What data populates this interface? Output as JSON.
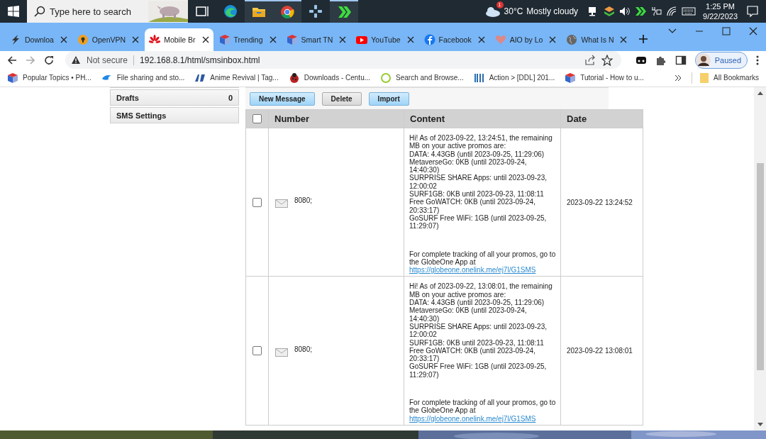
{
  "taskbar": {
    "search": {
      "placeholder": "Type here to search"
    },
    "apps": [
      {
        "kind": "taskview",
        "running": false
      },
      {
        "kind": "edge",
        "running": false
      },
      {
        "kind": "folder",
        "running": true
      },
      {
        "kind": "chrome",
        "running": true
      },
      {
        "kind": "gamepad",
        "running": false
      },
      {
        "kind": "chevrons",
        "running": true
      }
    ],
    "weather": {
      "badge": "1",
      "temperature": "30°C",
      "condition": "Mostly cloudy"
    },
    "clock": {
      "time": "1:25 PM",
      "date": "9/22/2023"
    }
  },
  "browser": {
    "tabs": [
      {
        "label": "Downloa",
        "kind": "bolt",
        "selected": false
      },
      {
        "label": "OpenVPN",
        "kind": "lock",
        "selected": false
      },
      {
        "label": "Mobile Br",
        "kind": "flower",
        "selected": true
      },
      {
        "label": "Trending",
        "kind": "cube",
        "selected": false
      },
      {
        "label": "Smart TN",
        "kind": "cube",
        "selected": false
      },
      {
        "label": "YouTube",
        "kind": "play",
        "selected": false
      },
      {
        "label": "Facebook",
        "kind": "facebook",
        "selected": false
      },
      {
        "label": "AIO by Lo",
        "kind": "heart",
        "selected": false
      },
      {
        "label": "What Is N",
        "kind": "globe",
        "selected": false
      }
    ],
    "address": {
      "security": "Not secure",
      "url": "192.168.8.1/html/smsinbox.html"
    },
    "profile": {
      "status": "Paused"
    },
    "bookmarks": [
      {
        "label": "Popular Topics • PH...",
        "kind": "cube"
      },
      {
        "label": "File sharing and sto...",
        "kind": "swirl"
      },
      {
        "label": "Anime Revival | Tag...",
        "kind": "mark"
      },
      {
        "label": "Downloads - Centu...",
        "kind": "bug"
      },
      {
        "label": "Search and Browse...",
        "kind": "ring"
      },
      {
        "label": "Action > [DDL] 201...",
        "kind": "bars"
      },
      {
        "label": "Tutorial - How to u...",
        "kind": "cube"
      }
    ],
    "all_bookmarks": "All Bookmarks"
  },
  "page": {
    "sidebar": [
      {
        "label": "Drafts",
        "count": "0"
      },
      {
        "label": "SMS Settings"
      }
    ],
    "toolbar": [
      {
        "label": "New Message",
        "kind": "primary"
      },
      {
        "label": "Delete",
        "kind": "secondary"
      },
      {
        "label": "Import",
        "kind": "primary"
      }
    ],
    "table": {
      "all_checked": false,
      "columns": [
        "Number",
        "Content",
        "Date"
      ],
      "rows": [
        {
          "checked": false,
          "number": "8080;",
          "content": [
            "Hi! As of 2023-09-22, 13:24:51, the remaining MB on your active promos are:",
            "DATA: 4.43GB (until 2023-09-25, 11:29:06)",
            "MetaverseGo: 0KB (until 2023-09-24, 14:40:30)",
            "SURPRISE SHARE Apps: until 2023-09-23, 12:00:02",
            "SURF1GB: 0KB until 2023-09-23, 11:08:11",
            "Free GoWATCH: 0KB (until 2023-09-24, 20:33:17)",
            "GoSURF Free WiFi: 1GB (until 2023-09-25, 11:29:07)"
          ],
          "footer": "For complete tracking of all your promos, go to the GlobeOne App at",
          "link": "https://globeone.onelink.me/ej7l/G1SMS",
          "date": "2023-09-22 13:24:52"
        },
        {
          "checked": false,
          "number": "8080;",
          "content": [
            "Hi! As of 2023-09-22, 13:08:01, the remaining MB on your active promos are:",
            "DATA: 4.43GB (until 2023-09-25, 11:29:06)",
            "MetaverseGo: 0KB (until 2023-09-24, 14:40:30)",
            "SURPRISE SHARE Apps: until 2023-09-23, 12:00:02",
            "SURF1GB: 0KB until 2023-09-23, 11:08:11",
            "Free GoWATCH: 0KB (until 2023-09-24, 20:33:17)",
            "GoSURF Free WiFi: 1GB (until 2023-09-25, 11:29:07)"
          ],
          "footer": "For complete tracking of all your promos, go to the GlobeOne App at",
          "link": "https://globeone.onelink.me/ej7l/G1SMS",
          "date": "2023-09-22 13:08:01"
        }
      ]
    }
  }
}
